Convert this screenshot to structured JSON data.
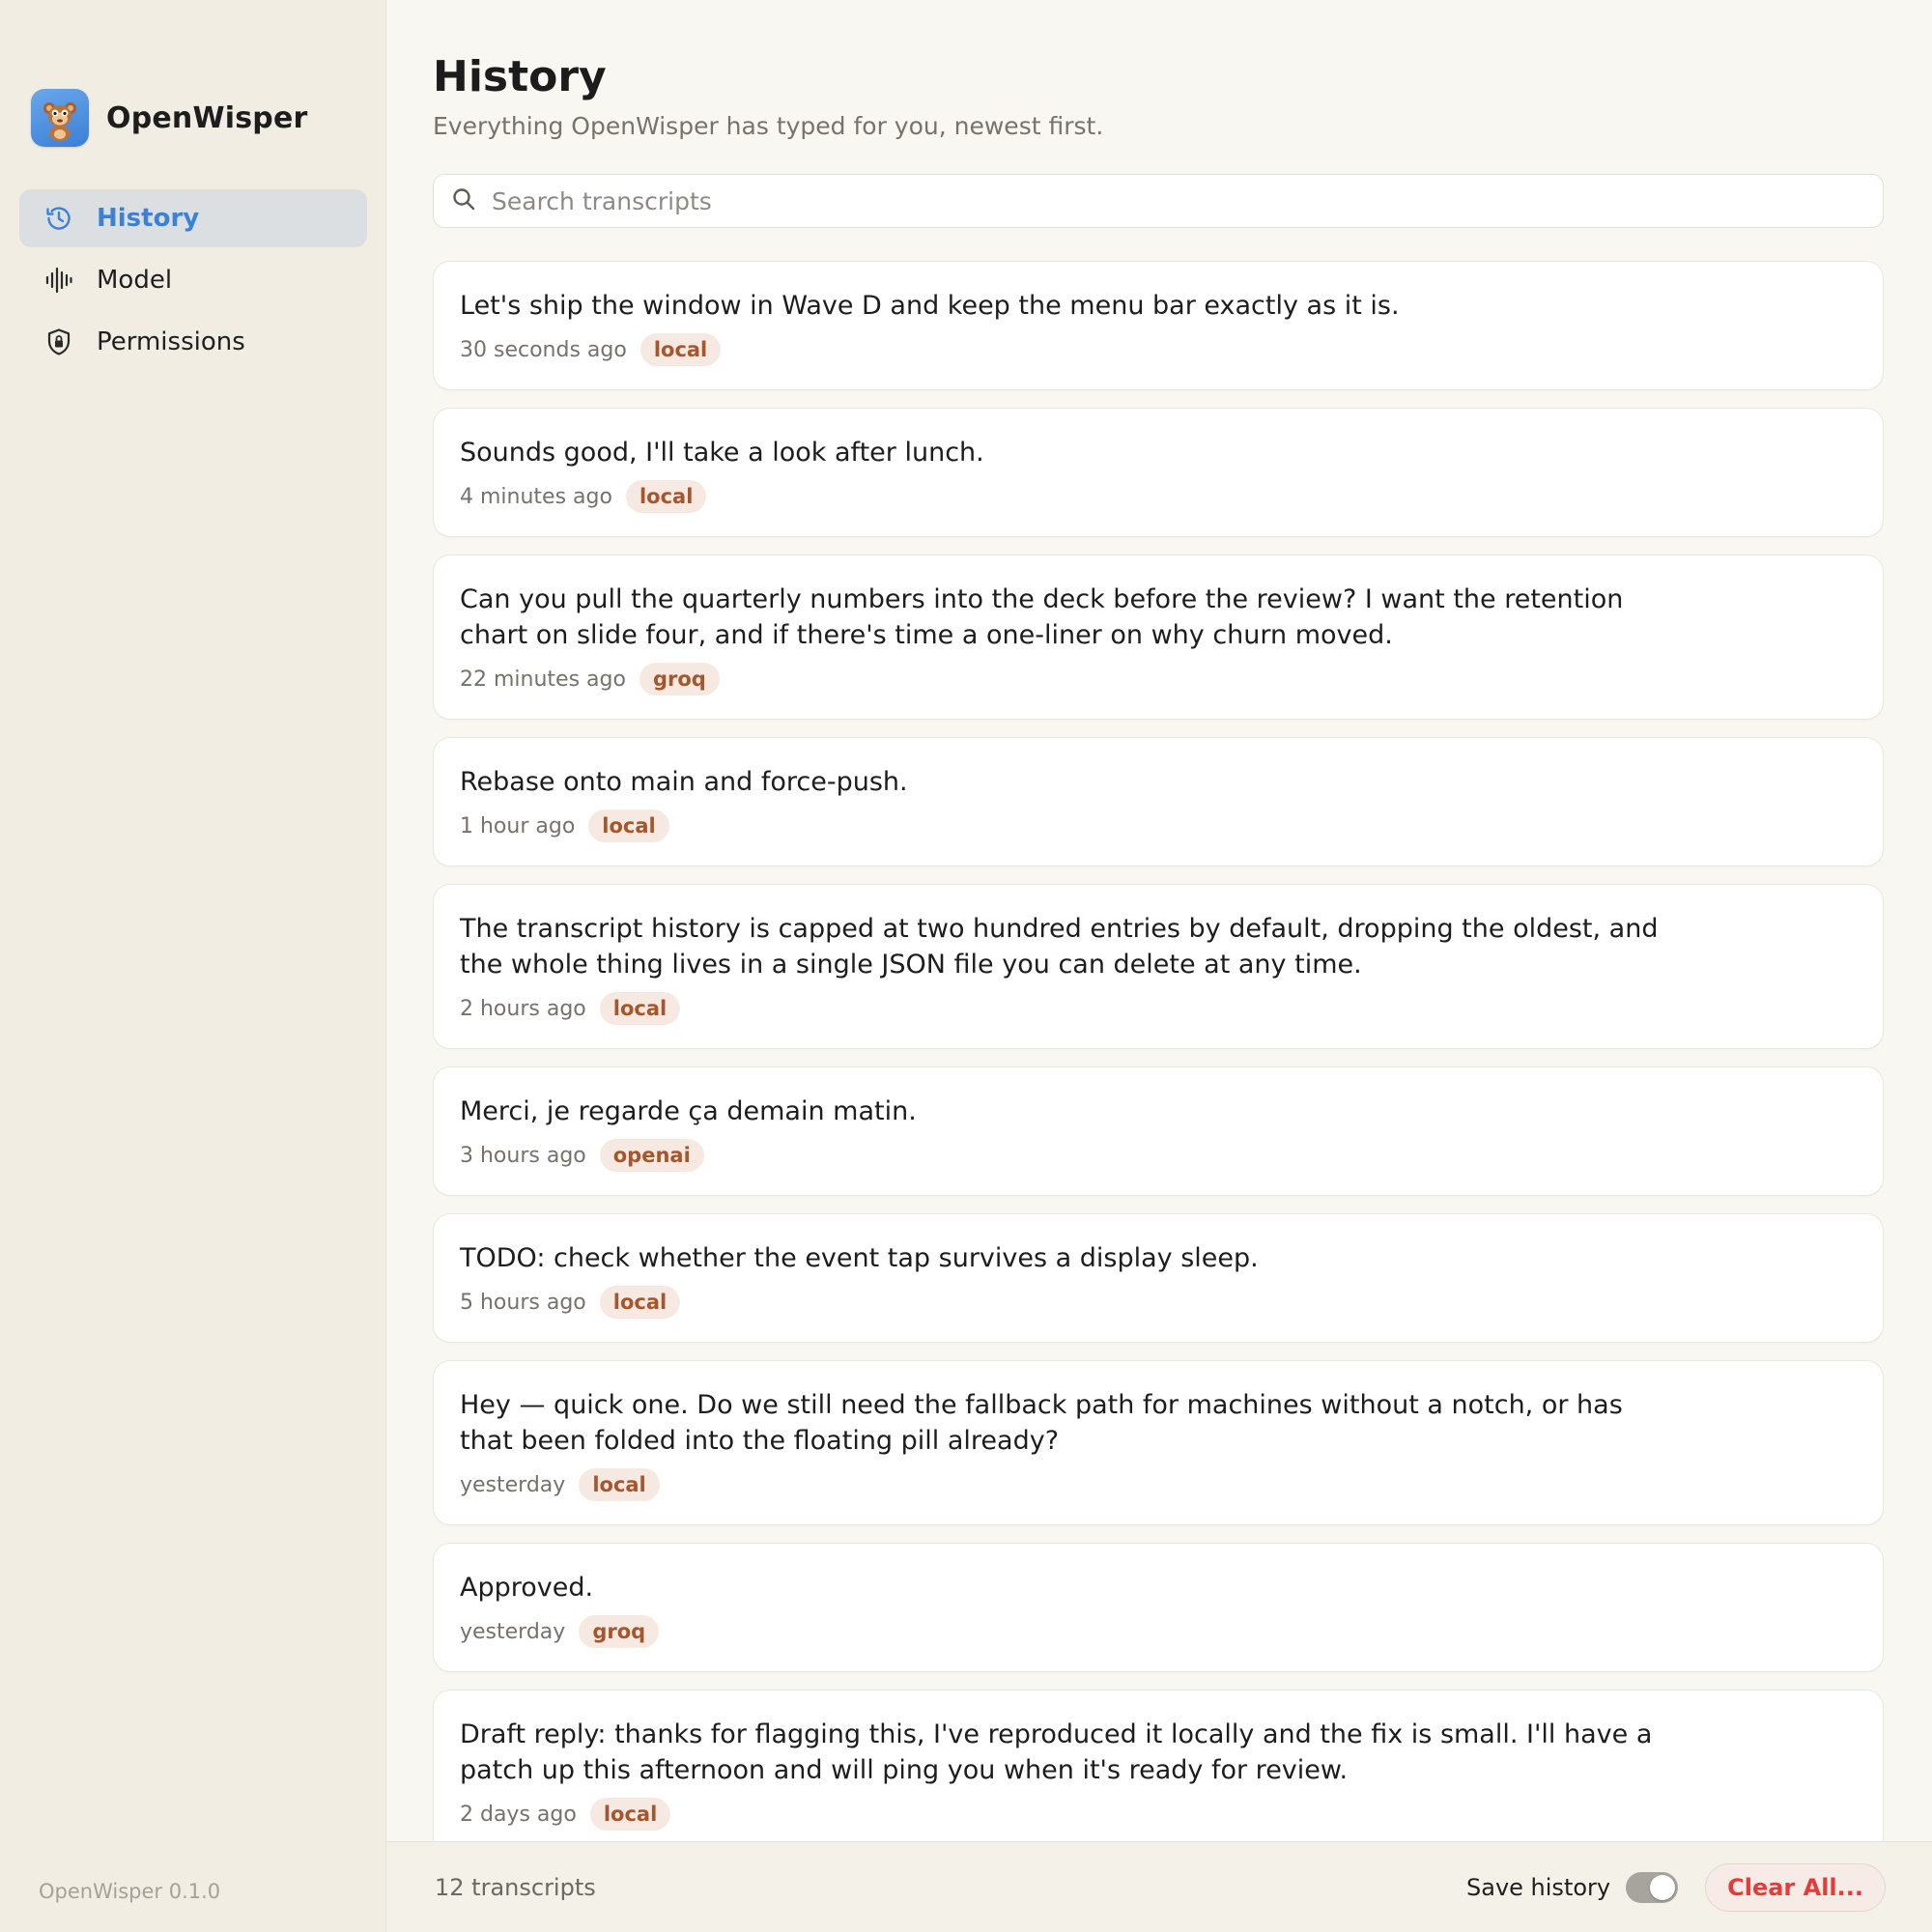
{
  "app": {
    "name": "OpenWisper",
    "version": "OpenWisper 0.1.0",
    "accent_color": "#3b82d6"
  },
  "sidebar": {
    "items": [
      {
        "label": "History",
        "icon": "history-icon",
        "active": true
      },
      {
        "label": "Model",
        "icon": "waveform-icon",
        "active": false
      },
      {
        "label": "Permissions",
        "icon": "shield-lock-icon",
        "active": false
      }
    ]
  },
  "header": {
    "title": "History",
    "subtitle": "Everything OpenWisper has typed for you, newest first."
  },
  "search": {
    "placeholder": "Search transcripts",
    "value": "",
    "icon": "search-icon"
  },
  "transcripts": [
    {
      "text": "Let's ship the window in Wave D and keep the menu bar exactly as it is.",
      "time": "30 seconds ago",
      "source": "local"
    },
    {
      "text": "Sounds good, I'll take a look after lunch.",
      "time": "4 minutes ago",
      "source": "local"
    },
    {
      "text": "Can you pull the quarterly numbers into the deck before the review? I want the retention chart on slide four, and if there's time a one-liner on why churn moved.",
      "time": "22 minutes ago",
      "source": "groq"
    },
    {
      "text": "Rebase onto main and force-push.",
      "time": "1 hour ago",
      "source": "local"
    },
    {
      "text": "The transcript history is capped at two hundred entries by default, dropping the oldest, and the whole thing lives in a single JSON file you can delete at any time.",
      "time": "2 hours ago",
      "source": "local"
    },
    {
      "text": "Merci, je regarde ça demain matin.",
      "time": "3 hours ago",
      "source": "openai"
    },
    {
      "text": "TODO: check whether the event tap survives a display sleep.",
      "time": "5 hours ago",
      "source": "local"
    },
    {
      "text": "Hey — quick one. Do we still need the fallback path for machines without a notch, or has that been folded into the floating pill already?",
      "time": "yesterday",
      "source": "local"
    },
    {
      "text": "Approved.",
      "time": "yesterday",
      "source": "groq"
    },
    {
      "text": "Draft reply: thanks for flagging this, I've reproduced it locally and the fix is small. I'll have a patch up this afternoon and will ping you when it's ready for review.",
      "time": "2 days ago",
      "source": "local"
    }
  ],
  "footer": {
    "count": "12 transcripts",
    "save_history_label": "Save history",
    "save_history_on": true,
    "clear_label": "Clear All...",
    "clear_color": "#e33c3c"
  }
}
